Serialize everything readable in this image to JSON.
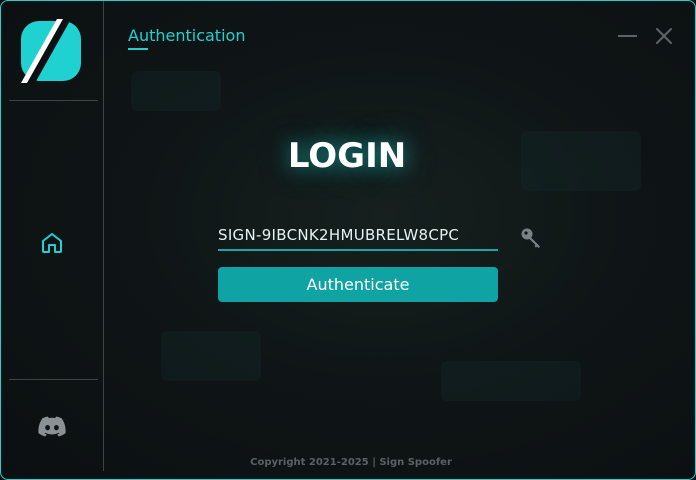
{
  "app": {
    "accent_color": "#1fd1d1",
    "button_color": "#0fa3a3"
  },
  "sidebar": {
    "logo_icon": "sign-spoofer-logo",
    "nav_items": [
      {
        "icon": "home-icon"
      },
      {
        "icon": "discord-icon"
      }
    ]
  },
  "header": {
    "tab_label": "Authentication"
  },
  "window_controls": {
    "minimize_icon": "minimize-icon",
    "close_icon": "close-icon"
  },
  "login": {
    "title": "LOGIN",
    "key_value": "SIGN-9IBCNK2HMUBRELW8CPC",
    "key_icon": "key-icon",
    "button_label": "Authenticate"
  },
  "footer": {
    "copyright": "Copyright 2021-2025 | Sign Spoofer"
  }
}
